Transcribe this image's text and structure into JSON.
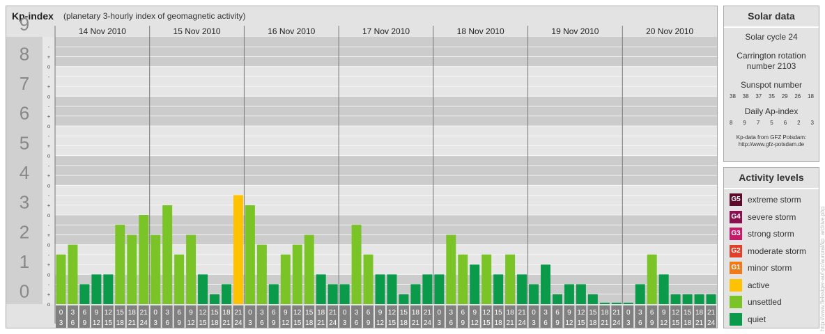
{
  "header": {
    "title": "Kp-index",
    "subtitle": "(planetary 3-hourly index of geomagnetic activity)"
  },
  "chart_data": {
    "type": "bar",
    "title": "Kp-index",
    "subtitle": "(planetary 3-hourly index of geomagnetic activity)",
    "ylim": [
      0,
      9
    ],
    "y_ticks": [
      "0",
      "1",
      "2",
      "3",
      "4",
      "5",
      "6",
      "7",
      "8",
      "9"
    ],
    "y_minor_ticks": [
      "o",
      "+",
      "-"
    ],
    "days": [
      "14 Nov 2010",
      "15 Nov 2010",
      "16 Nov 2010",
      "17 Nov 2010",
      "18 Nov 2010",
      "19 Nov 2010",
      "20 Nov 2010"
    ],
    "interval_labels": [
      [
        "0",
        "3"
      ],
      [
        "3",
        "6"
      ],
      [
        "6",
        "9"
      ],
      [
        "9",
        "12"
      ],
      [
        "12",
        "15"
      ],
      [
        "15",
        "18"
      ],
      [
        "18",
        "21"
      ],
      [
        "21",
        "24"
      ]
    ],
    "values": [
      [
        1.67,
        2.0,
        0.67,
        1.0,
        1.0,
        2.67,
        2.33,
        3.0
      ],
      [
        2.33,
        3.33,
        1.67,
        2.33,
        1.0,
        0.33,
        0.67,
        3.67
      ],
      [
        3.33,
        2.0,
        0.67,
        1.67,
        2.0,
        2.33,
        1.0,
        0.67
      ],
      [
        0.67,
        2.67,
        1.67,
        1.0,
        1.0,
        0.33,
        0.67,
        1.0
      ],
      [
        1.0,
        2.33,
        1.67,
        1.33,
        1.67,
        1.0,
        1.67,
        1.0
      ],
      [
        0.67,
        1.33,
        0.33,
        0.67,
        0.67,
        0.33,
        0.0,
        0.0
      ],
      [
        0.0,
        0.67,
        1.67,
        1.0,
        0.33,
        0.33,
        0.33,
        0.33
      ]
    ],
    "colors": {
      "quiet": "#0a9a4a",
      "unsettled": "#7bc427",
      "active": "#ffc200",
      "grid_band_dark": "#cccccc",
      "grid_band_light": "#e6e6e6",
      "label_box": "#808080"
    },
    "legend": "right"
  },
  "solar": {
    "heading": "Solar data",
    "cycle": "Solar cycle 24",
    "carrington": "Carrington rotation number 2103",
    "sunspot_label": "Sunspot number",
    "sunspot_values": [
      "38",
      "38",
      "37",
      "35",
      "29",
      "26",
      "18"
    ],
    "ap_label": "Daily Ap-index",
    "ap_values": [
      "8",
      "9",
      "7",
      "5",
      "6",
      "2",
      "3"
    ],
    "credit_line1": "Kp-data from GFZ Potsdam:",
    "credit_line2": "http://www.gfz-potsdam.de"
  },
  "activity": {
    "heading": "Activity levels",
    "items": [
      {
        "code": "G5",
        "label": "extreme storm",
        "color": "#5a0a2a"
      },
      {
        "code": "G4",
        "label": "severe storm",
        "color": "#8a1050"
      },
      {
        "code": "G3",
        "label": "strong storm",
        "color": "#c8186a"
      },
      {
        "code": "G2",
        "label": "moderate storm",
        "color": "#e0402a"
      },
      {
        "code": "G1",
        "label": "minor storm",
        "color": "#f07a1a"
      },
      {
        "code": "",
        "label": "active",
        "color": "#ffc200"
      },
      {
        "code": "",
        "label": "unsettled",
        "color": "#7bc427"
      },
      {
        "code": "",
        "label": "quiet",
        "color": "#0a9a4a"
      }
    ]
  },
  "watermark": "http://www.fleissiger-auf-pc/auroral/kp_archive.php"
}
